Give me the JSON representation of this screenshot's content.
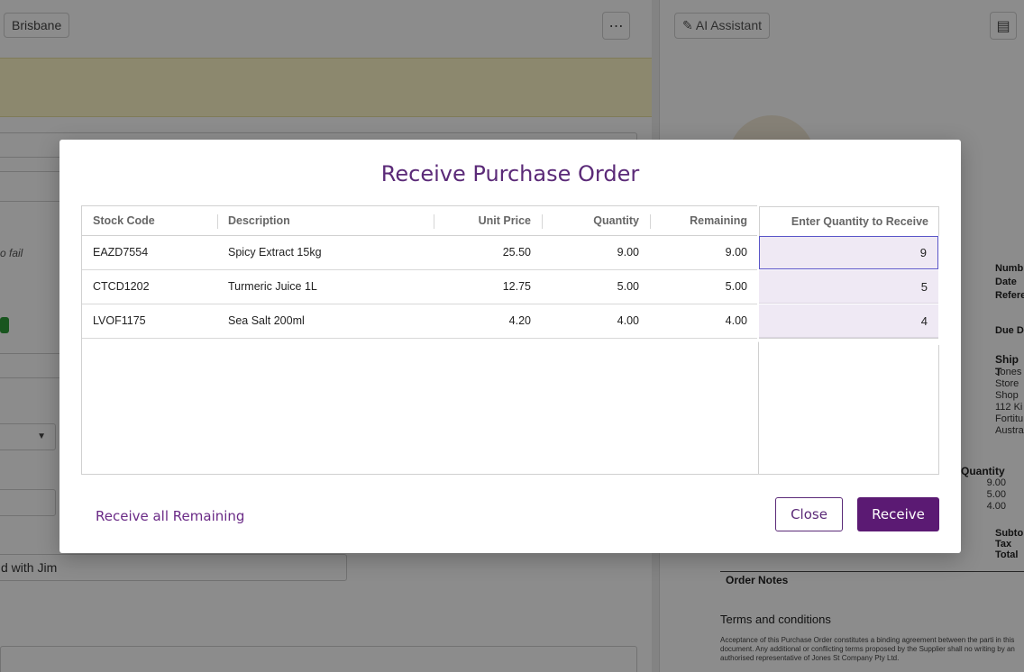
{
  "background": {
    "location_chip": "Brisbane",
    "ai_assistant_label": "AI Assistant",
    "more_icon": "ellipsis-icon",
    "pdf_icon": "document-icon",
    "note_fragment": "o fail",
    "received_note": "d with Jim",
    "document": {
      "labels": [
        "Numb",
        "Date",
        "Refere",
        "Due D",
        "Ship T"
      ],
      "ship_to_lines": [
        "Jones",
        "Store",
        "Shop",
        "112 Ki",
        "Fortitu",
        "Austra"
      ],
      "quantity_header": "Quantity",
      "quantities": [
        "9.00",
        "5.00",
        "4.00"
      ],
      "totals": [
        "Subto",
        "Tax",
        "Total"
      ],
      "order_notes": "Order Notes",
      "terms_title": "Terms and conditions",
      "terms_body": "Acceptance of this Purchase Order constitutes a binding agreement between the parti in this document. Any additional or conflicting terms proposed by the Supplier shall no writing by an authorised representative of Jones St Company Pty Ltd."
    }
  },
  "modal": {
    "title": "Receive Purchase Order",
    "columns": {
      "stock_code": "Stock Code",
      "description": "Description",
      "unit_price": "Unit Price",
      "quantity": "Quantity",
      "remaining": "Remaining",
      "enter_qty": "Enter Quantity to Receive"
    },
    "rows": [
      {
        "stock_code": "EAZD7554",
        "description": "Spicy Extract 15kg",
        "unit_price": "25.50",
        "quantity": "9.00",
        "remaining": "9.00",
        "receive_qty": "9"
      },
      {
        "stock_code": "CTCD1202",
        "description": "Turmeric Juice 1L",
        "unit_price": "12.75",
        "quantity": "5.00",
        "remaining": "5.00",
        "receive_qty": "5"
      },
      {
        "stock_code": "LVOF1175",
        "description": "Sea Salt 200ml",
        "unit_price": "4.20",
        "quantity": "4.00",
        "remaining": "4.00",
        "receive_qty": "4"
      }
    ],
    "receive_all_label": "Receive all Remaining",
    "close_label": "Close",
    "receive_label": "Receive"
  },
  "colors": {
    "accent": "#5b1a73",
    "title": "#5b2a78",
    "input_fill": "#efe9f4",
    "banner": "#fff8c8"
  }
}
